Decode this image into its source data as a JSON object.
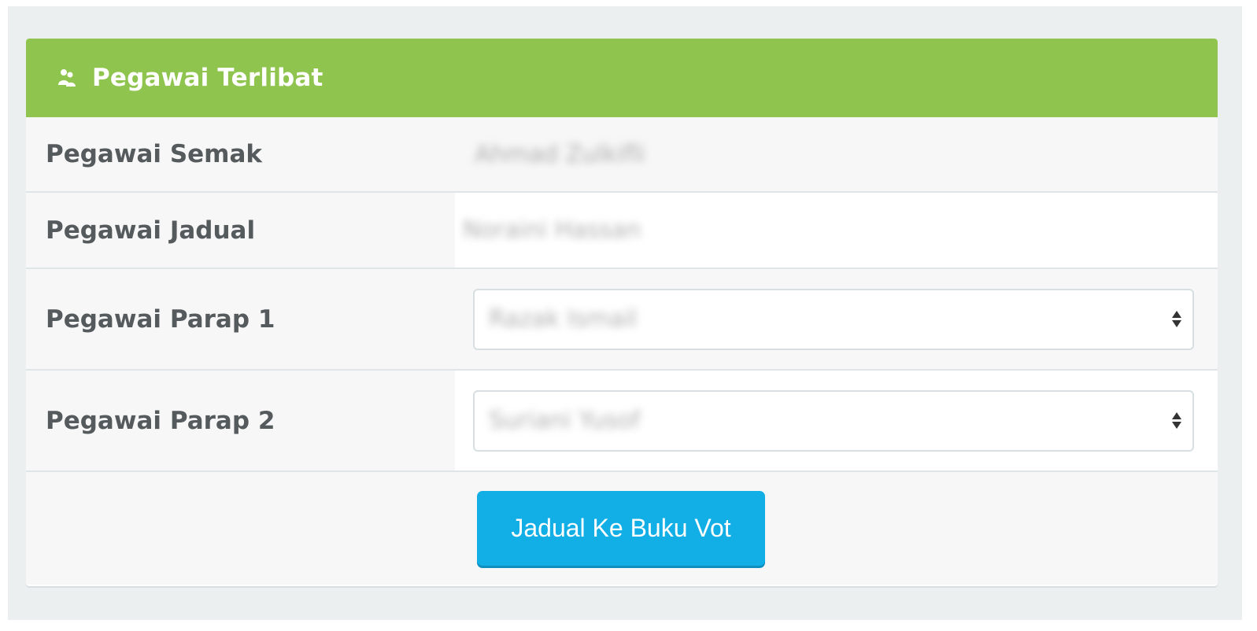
{
  "panel": {
    "title": "Pegawai Terlibat",
    "header_icon": "users-icon"
  },
  "rows": [
    {
      "label": "Pegawai Semak",
      "value": "Ahmad Zulkifli"
    },
    {
      "label": "Pegawai Jadual",
      "value": "Noraini Hassan"
    },
    {
      "label": "Pegawai Parap 1",
      "selected": "Razak Ismail",
      "control": "select"
    },
    {
      "label": "Pegawai Parap 2",
      "selected": "Suriani Yusof",
      "control": "select"
    }
  ],
  "footer": {
    "button_label": "Jadual Ke Buku Vot"
  },
  "colors": {
    "header_bg": "#8fc54e",
    "button_bg": "#12aee6",
    "page_bg": "#eceff0",
    "label_text": "#555a5d"
  }
}
